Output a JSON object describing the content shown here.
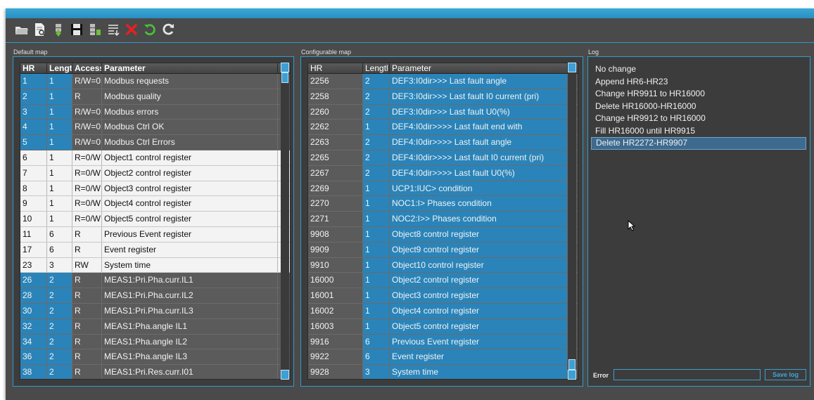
{
  "toolbar": {
    "buttons": [
      {
        "name": "open-folder-icon",
        "color": "#e6e6e6"
      },
      {
        "name": "view-document-icon",
        "color": "#e6e6e6"
      },
      {
        "name": "import-icon",
        "color": "#6fbf3f"
      },
      {
        "name": "save-icon",
        "color": "#e6e6e6"
      },
      {
        "name": "export-icon",
        "color": "#6fbf3f"
      },
      {
        "name": "list-icon",
        "color": "#e6e6e6"
      },
      {
        "name": "delete-icon",
        "color": "#e82020"
      },
      {
        "name": "undo-icon",
        "color": "#4cbf3a"
      },
      {
        "name": "refresh-icon",
        "color": "#e6e6e6"
      }
    ]
  },
  "default_map": {
    "title": "Default map",
    "columns": [
      "HR",
      "Lengt",
      "Access",
      "Parameter"
    ],
    "rows": [
      {
        "hr": "1",
        "len": "1",
        "access": "R/W=0",
        "param": "Modbus requests",
        "style": "dark"
      },
      {
        "hr": "2",
        "len": "1",
        "access": "R",
        "param": "Modbus quality",
        "style": "dark"
      },
      {
        "hr": "3",
        "len": "1",
        "access": "R/W=0",
        "param": "Modbus errors",
        "style": "dark"
      },
      {
        "hr": "4",
        "len": "1",
        "access": "R/W=0",
        "param": "Modbus Ctrl OK",
        "style": "dark"
      },
      {
        "hr": "5",
        "len": "1",
        "access": "R/W=0",
        "param": "Modbus Ctrl Errors",
        "style": "dark"
      },
      {
        "hr": "6",
        "len": "1",
        "access": "R=0/W",
        "param": "Object1 control register",
        "style": "light"
      },
      {
        "hr": "7",
        "len": "1",
        "access": "R=0/W",
        "param": "Object2 control register",
        "style": "light"
      },
      {
        "hr": "8",
        "len": "1",
        "access": "R=0/W",
        "param": "Object3 control register",
        "style": "light"
      },
      {
        "hr": "9",
        "len": "1",
        "access": "R=0/W",
        "param": "Object4 control register",
        "style": "light"
      },
      {
        "hr": "10",
        "len": "1",
        "access": "R=0/W",
        "param": "Object5 control register",
        "style": "light"
      },
      {
        "hr": "11",
        "len": "6",
        "access": "R",
        "param": "Previous Event register",
        "style": "light"
      },
      {
        "hr": "17",
        "len": "6",
        "access": "R",
        "param": "Event register",
        "style": "light"
      },
      {
        "hr": "23",
        "len": "3",
        "access": "RW",
        "param": "System time",
        "style": "light"
      },
      {
        "hr": "26",
        "len": "2",
        "access": "R",
        "param": "MEAS1:Pri.Pha.curr.IL1",
        "style": "dark"
      },
      {
        "hr": "28",
        "len": "2",
        "access": "R",
        "param": "MEAS1:Pri.Pha.curr.IL2",
        "style": "dark"
      },
      {
        "hr": "30",
        "len": "2",
        "access": "R",
        "param": "MEAS1:Pri.Pha.curr.IL3",
        "style": "dark"
      },
      {
        "hr": "32",
        "len": "2",
        "access": "R",
        "param": "MEAS1:Pha.angle IL1",
        "style": "dark"
      },
      {
        "hr": "34",
        "len": "2",
        "access": "R",
        "param": "MEAS1:Pha.angle IL2",
        "style": "dark"
      },
      {
        "hr": "36",
        "len": "2",
        "access": "R",
        "param": "MEAS1:Pha.angle IL3",
        "style": "dark"
      },
      {
        "hr": "38",
        "len": "2",
        "access": "R",
        "param": "MEAS1:Pri.Res.curr.I01",
        "style": "dark"
      }
    ]
  },
  "configurable_map": {
    "title": "Configurable map",
    "columns": [
      "HR",
      "Lengtl",
      "Parameter"
    ],
    "rows": [
      {
        "hr": "2256",
        "len": "2",
        "param": "DEF3:I0dir>>> Last fault angle"
      },
      {
        "hr": "2258",
        "len": "2",
        "param": "DEF3:I0dir>>> Last fault I0 current (pri)"
      },
      {
        "hr": "2260",
        "len": "2",
        "param": "DEF3:I0dir>>> Last fault U0(%)"
      },
      {
        "hr": "2262",
        "len": "1",
        "param": "DEF4:I0dir>>>> Last fault end with"
      },
      {
        "hr": "2263",
        "len": "2",
        "param": "DEF4:I0dir>>>> Last fault angle"
      },
      {
        "hr": "2265",
        "len": "2",
        "param": "DEF4:I0dir>>>> Last fault I0 current (pri)"
      },
      {
        "hr": "2267",
        "len": "2",
        "param": "DEF4:I0dir>>>> Last fault U0(%)"
      },
      {
        "hr": "2269",
        "len": "1",
        "param": "UCP1:IUC> condition"
      },
      {
        "hr": "2270",
        "len": "1",
        "param": "NOC1:I> Phases condition"
      },
      {
        "hr": "2271",
        "len": "1",
        "param": "NOC2:I>> Phases condition"
      },
      {
        "hr": "9908",
        "len": "1",
        "param": "Object8 control register"
      },
      {
        "hr": "9909",
        "len": "1",
        "param": "Object9 control register"
      },
      {
        "hr": "9910",
        "len": "1",
        "param": "Object10 control register"
      },
      {
        "hr": "16000",
        "len": "1",
        "param": "Object2 control register"
      },
      {
        "hr": "16001",
        "len": "1",
        "param": "Object3 control register"
      },
      {
        "hr": "16002",
        "len": "1",
        "param": "Object4 control register"
      },
      {
        "hr": "16003",
        "len": "1",
        "param": "Object5 control register"
      },
      {
        "hr": "9916",
        "len": "6",
        "param": "Previous Event register"
      },
      {
        "hr": "9922",
        "len": "6",
        "param": "Event register"
      },
      {
        "hr": "9928",
        "len": "3",
        "param": "System time"
      }
    ]
  },
  "log": {
    "title": "Log",
    "items": [
      "No change",
      "Append HR6-HR23",
      "Change HR9911 to HR16000",
      "Delete HR16000-HR16000",
      "Change HR9912 to HR16000",
      "Fill HR16000 until HR9915",
      "Delete HR2272-HR9907"
    ],
    "selected_index": 6,
    "error_label": "Error",
    "error_value": "",
    "save_label": "Save log"
  }
}
